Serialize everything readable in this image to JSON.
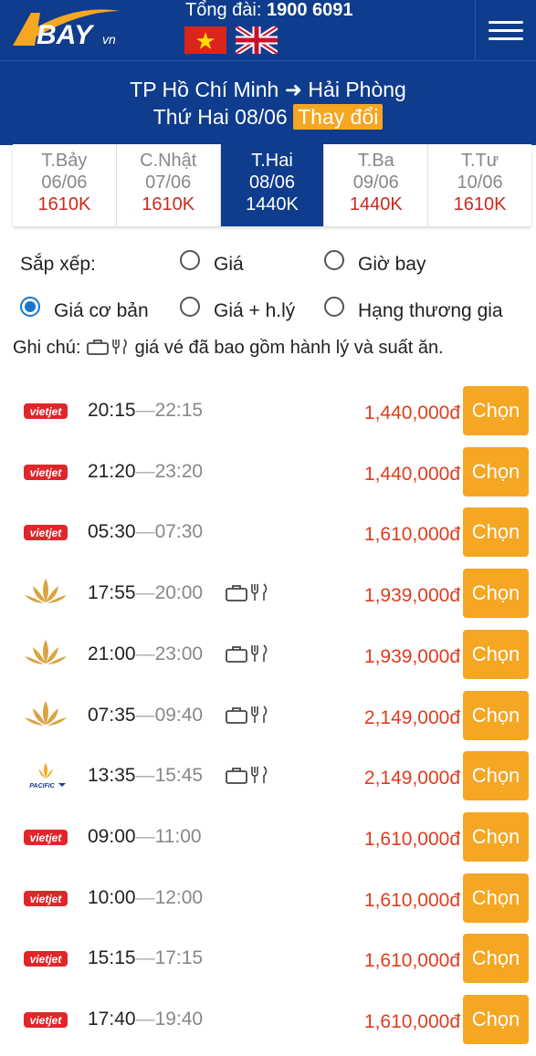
{
  "header": {
    "logo_text": "BAY",
    "logo_suffix": "vn",
    "hotline_label": "Tổng đài:",
    "hotline_number": "1900 6091",
    "menu_icon": "hamburger-icon"
  },
  "route": {
    "from": "TP Hồ Chí Minh",
    "to": "Hải Phòng",
    "date": "Thứ Hai 08/06",
    "change_label": "Thay đổi"
  },
  "dates": [
    {
      "day": "T.Bảy",
      "date": "06/06",
      "price": "1610K",
      "active": false
    },
    {
      "day": "C.Nhật",
      "date": "07/06",
      "price": "1610K",
      "active": false
    },
    {
      "day": "T.Hai",
      "date": "08/06",
      "price": "1440K",
      "active": true
    },
    {
      "day": "T.Ba",
      "date": "09/06",
      "price": "1440K",
      "active": false
    },
    {
      "day": "T.Tư",
      "date": "10/06",
      "price": "1610K",
      "active": false
    }
  ],
  "sort": {
    "label": "Sắp xếp:",
    "options": [
      {
        "label": "Giá",
        "selected": false
      },
      {
        "label": "Giờ bay",
        "selected": false
      },
      {
        "label": "Giá cơ bản",
        "selected": true
      },
      {
        "label": "Giá + h.lý",
        "selected": false
      },
      {
        "label": "Hạng thương gia",
        "selected": false
      }
    ]
  },
  "note": {
    "prefix": "Ghi chú:",
    "text": "giá vé đã bao gồm hành lý và suất ăn."
  },
  "select_label": "Chọn",
  "flights": [
    {
      "airline": "vietjet",
      "dep": "20:15",
      "arr": "22:15",
      "perks": false,
      "price": "1,440,000đ"
    },
    {
      "airline": "vietjet",
      "dep": "21:20",
      "arr": "23:20",
      "perks": false,
      "price": "1,440,000đ"
    },
    {
      "airline": "vietjet",
      "dep": "05:30",
      "arr": "07:30",
      "perks": false,
      "price": "1,610,000đ"
    },
    {
      "airline": "vietnam-airlines",
      "dep": "17:55",
      "arr": "20:00",
      "perks": true,
      "price": "1,939,000đ"
    },
    {
      "airline": "vietnam-airlines",
      "dep": "21:00",
      "arr": "23:00",
      "perks": true,
      "price": "1,939,000đ"
    },
    {
      "airline": "vietnam-airlines",
      "dep": "07:35",
      "arr": "09:40",
      "perks": true,
      "price": "2,149,000đ"
    },
    {
      "airline": "pacific",
      "dep": "13:35",
      "arr": "15:45",
      "perks": true,
      "price": "2,149,000đ"
    },
    {
      "airline": "vietjet",
      "dep": "09:00",
      "arr": "11:00",
      "perks": false,
      "price": "1,610,000đ"
    },
    {
      "airline": "vietjet",
      "dep": "10:00",
      "arr": "12:00",
      "perks": false,
      "price": "1,610,000đ"
    },
    {
      "airline": "vietjet",
      "dep": "15:15",
      "arr": "17:15",
      "perks": false,
      "price": "1,610,000đ"
    },
    {
      "airline": "vietjet",
      "dep": "17:40",
      "arr": "19:40",
      "perks": false,
      "price": "1,610,000đ"
    }
  ],
  "airline_labels": {
    "vietjet": "vietjet",
    "pacific": "PACIFIC"
  },
  "colors": {
    "brand_blue": "#0f3c8c",
    "accent_orange": "#f5a623",
    "price_red": "#e03c1f"
  }
}
